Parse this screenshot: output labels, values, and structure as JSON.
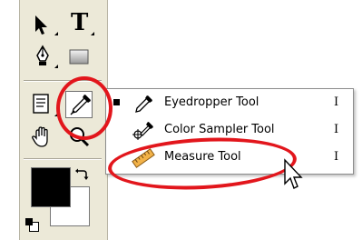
{
  "toolbox": {
    "tools": [
      {
        "name": "move-tool",
        "icon": "move-arrow-icon"
      },
      {
        "name": "type-tool",
        "icon": "type-icon",
        "glyph": "T"
      },
      {
        "name": "pen-tool",
        "icon": "pen-icon"
      },
      {
        "name": "rectangle-tool",
        "icon": "rectangle-icon"
      },
      {
        "name": "notes-tool",
        "icon": "notes-icon"
      },
      {
        "name": "eyedropper-tool",
        "icon": "eyedropper-icon",
        "active": true
      },
      {
        "name": "hand-tool",
        "icon": "hand-icon"
      },
      {
        "name": "zoom-tool",
        "icon": "magnifier-icon"
      }
    ],
    "foreground_color": "#000000",
    "background_color": "#ffffff"
  },
  "flyout": {
    "items": [
      {
        "label": "Eyedropper Tool",
        "shortcut": "I",
        "icon": "eyedropper-icon",
        "selected": true
      },
      {
        "label": "Color Sampler Tool",
        "shortcut": "I",
        "icon": "color-sampler-icon",
        "selected": false
      },
      {
        "label": "Measure Tool",
        "shortcut": "I",
        "icon": "ruler-icon",
        "selected": false
      }
    ]
  },
  "annotation_color": "#e2161c"
}
